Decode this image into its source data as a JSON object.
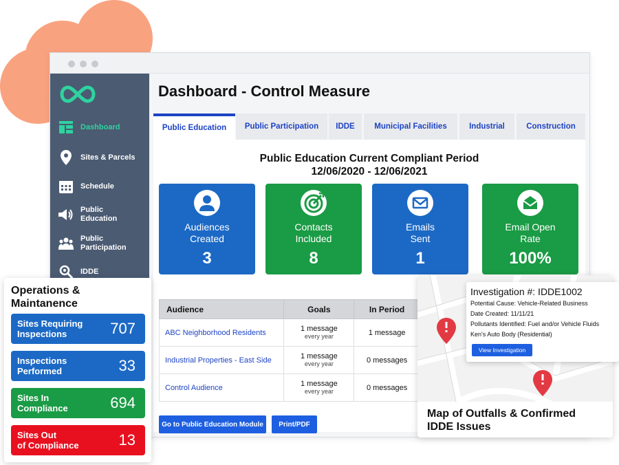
{
  "page": {
    "title": "Dashboard - Control Measure",
    "colors": {
      "blue": "#1c69c5",
      "green": "#1a9b45",
      "red": "#e8101f",
      "sidebar": "#4b5b72",
      "accent": "#2ed3a0",
      "link": "#1d43c4"
    }
  },
  "sidebar": {
    "logo_icon": "infinity-logo-icon",
    "items": [
      {
        "label": "Dashboard",
        "icon": "dashboard-grid-icon"
      },
      {
        "label": "Sites & Parcels",
        "icon": "map-pin-icon"
      },
      {
        "label": "Schedule",
        "icon": "calendar-icon"
      },
      {
        "label": "Public Education",
        "icon": "megaphone-icon"
      },
      {
        "label": "Public Participation",
        "icon": "people-icon"
      },
      {
        "label": "IDDE",
        "icon": "search-icon"
      }
    ]
  },
  "tabs": [
    {
      "label": "Public Education"
    },
    {
      "label": "Public Participation"
    },
    {
      "label": "IDDE"
    },
    {
      "label": "Municipal Facilities"
    },
    {
      "label": "Industrial"
    },
    {
      "label": "Construction"
    }
  ],
  "period": {
    "title": "Public Education Current Compliant Period",
    "range": "12/06/2020 - 12/06/2021"
  },
  "stats": [
    {
      "label": "Audiences Created",
      "value": "3",
      "icon": "user-icon"
    },
    {
      "label": "Contacts Included",
      "value": "8",
      "icon": "target-icon"
    },
    {
      "label": "Emails Sent",
      "value": "1",
      "icon": "mail-icon"
    },
    {
      "label": "Email Open Rate",
      "value": "100%",
      "icon": "open-mail-icon"
    }
  ],
  "table": {
    "headers": [
      "Audience",
      "Goals",
      "In Period"
    ],
    "rows": [
      {
        "audience": "ABC Neighborhood Residents",
        "goal": "1 message",
        "goal_sub": "every year",
        "period": "1 message"
      },
      {
        "audience": "Industrial Properties - East Side",
        "goal": "1 message",
        "goal_sub": "every year",
        "period": "0 messages"
      },
      {
        "audience": "Control Audience",
        "goal": "1 message",
        "goal_sub": "every year",
        "period": "0 messages"
      }
    ]
  },
  "buttons": {
    "module": "Go to Public Education Module",
    "print": "Print/PDF"
  },
  "operations": {
    "title_line1": "Operations &",
    "title_line2": "Maintanence",
    "items": [
      {
        "label_line1": "Sites Requiring",
        "label_line2": "Inspections",
        "value": "707"
      },
      {
        "label_line1": "Inspections",
        "label_line2": "Performed",
        "value": "33"
      },
      {
        "label_line1": "Sites In",
        "label_line2": "Compliance",
        "value": "694"
      },
      {
        "label_line1": "Sites Out",
        "label_line2": "of Compliance",
        "value": "13"
      }
    ]
  },
  "map": {
    "caption_line1": "Map of Outfalls & Confirmed",
    "caption_line2": "IDDE Issues",
    "marker_icon": "alert-pin-icon"
  },
  "investigation": {
    "title": "Investigation #: IDDE1002",
    "cause": "Potential Cause: Vehicle-Related Business",
    "date": "Date Created: 11/11/21",
    "pollutants": "Pollutants Identified: Fuel and/or Vehicle Fluids",
    "site": "Ken's Auto Body (Residential)",
    "button": "View Investigation"
  }
}
